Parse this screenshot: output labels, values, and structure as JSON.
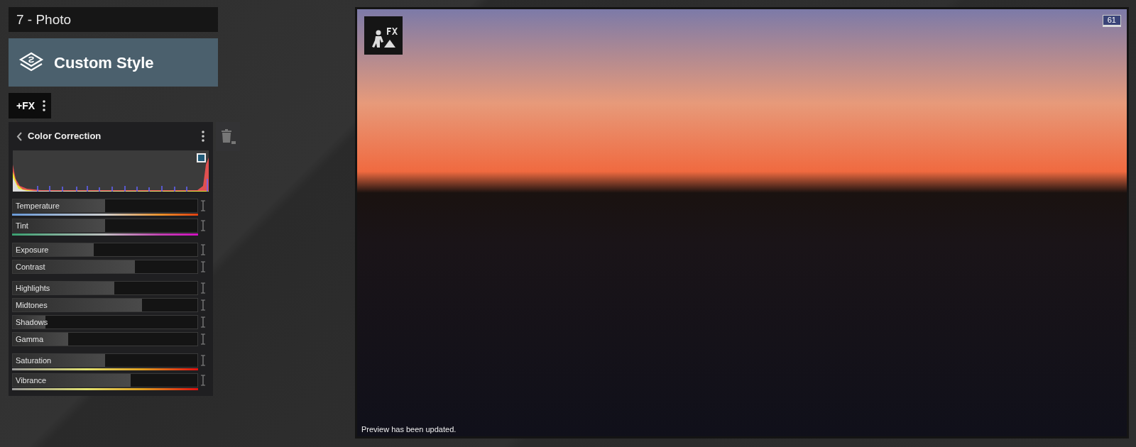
{
  "layer_title": "7 - Photo",
  "style_button": {
    "label": "Custom Style"
  },
  "fx_button": {
    "label": "+FX"
  },
  "effect_panel": {
    "title": "Color Correction",
    "slider_groups": [
      [
        {
          "label": "Temperature",
          "kind": "temp",
          "level": 0.5
        },
        {
          "label": "Tint",
          "kind": "tint",
          "level": 0.5
        }
      ],
      [
        {
          "label": "Exposure",
          "kind": "plain",
          "level": 0.44
        },
        {
          "label": "Contrast",
          "kind": "plain",
          "level": 0.66
        }
      ],
      [
        {
          "label": "Highlights",
          "kind": "plain",
          "level": 0.55
        },
        {
          "label": "Midtones",
          "kind": "plain",
          "level": 0.7
        },
        {
          "label": "Shadows",
          "kind": "plain",
          "level": 0.175
        },
        {
          "label": "Gamma",
          "kind": "plain",
          "level": 0.3
        }
      ],
      [
        {
          "label": "Saturation",
          "kind": "chroma",
          "level": 0.5
        },
        {
          "label": "Vibrance",
          "kind": "chroma",
          "level": 0.64
        }
      ]
    ]
  },
  "preview": {
    "frame_badge": "61",
    "status": "Preview has been updated."
  }
}
